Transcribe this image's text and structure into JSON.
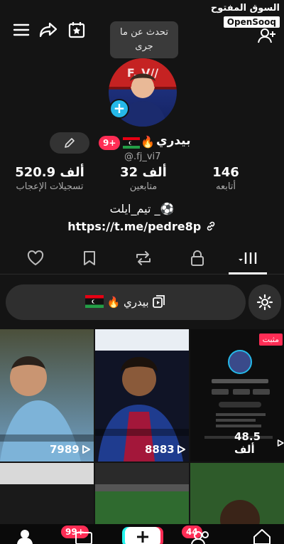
{
  "watermark": {
    "arabic": "السوق المفتوح",
    "brand": "OpenSooq"
  },
  "tooltip": {
    "line1": "تحدث عن ما",
    "line2": "جرى"
  },
  "profile": {
    "display_name": "بيدري",
    "notif_badge": "9+",
    "username": "@.fj_vi7"
  },
  "stats": [
    {
      "value": "146",
      "label": "أتابعه"
    },
    {
      "value": "32 ألف",
      "label": "متابعين"
    },
    {
      "value": "520.9 ألف",
      "label": "تسجيلات الإعجاب"
    }
  ],
  "bio": "تيم_ايلت _⚽",
  "link": "https://t.me/pedre8p",
  "playlist": {
    "label": "بيدري"
  },
  "videos": [
    {
      "views": "7989",
      "pinned": ""
    },
    {
      "views": "8883",
      "pinned": ""
    },
    {
      "views": "48.5 ألف",
      "pinned": "مثبت"
    }
  ],
  "bottom_nav": {
    "inbox_badge": "99+",
    "friends_badge": "44"
  },
  "colors": {
    "accent": "#ff2d55",
    "avatar_plus": "#25b8e8",
    "background": "#141414"
  }
}
